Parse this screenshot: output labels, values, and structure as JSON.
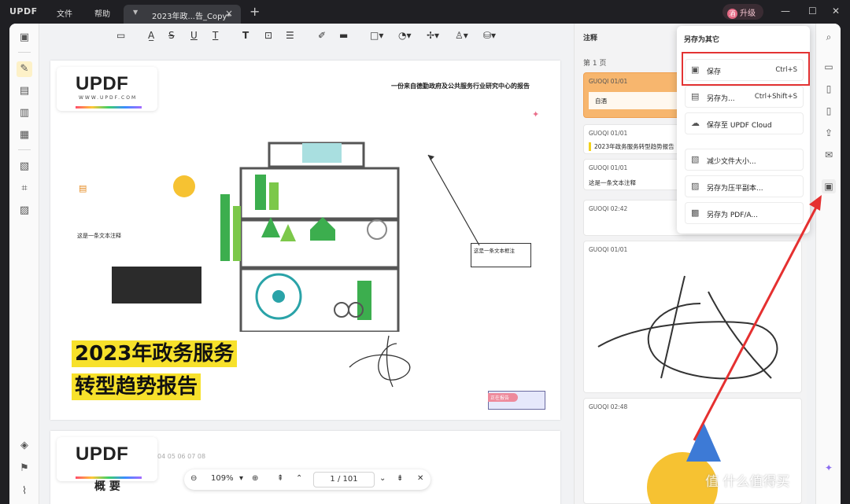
{
  "app": {
    "logo": "UPDF",
    "menus": [
      "文件",
      "帮助"
    ],
    "tab_title": "2023年政...告_Copy*",
    "upgrade": "升级",
    "avatar": "酒"
  },
  "toolbar": {
    "icons": [
      "comment-icon",
      "highlight-icon",
      "strikethrough-icon",
      "underline-icon",
      "squiggly-icon",
      "text-icon",
      "textbox-icon",
      "textcallout-icon",
      "pencil-icon",
      "eraser-icon",
      "shape-icon",
      "sticker-icon",
      "pin-icon",
      "stamp-icon"
    ]
  },
  "document": {
    "logo_word": "UPDF",
    "logo_url": "WWW.UPDF.COM",
    "subtitle": "一份来自德勤政府及公共服务行业研究中心的报告",
    "title_line1": "2023年政务服务",
    "title_line2": "转型趋势报告",
    "note_text": "这是一条文本注释",
    "textbox_text": "这是一条文本框注",
    "tag_text": "正在报告",
    "page2_logo": "UPDF",
    "page2_nums": "04  05  06  07  08",
    "page2_heading": "概 要"
  },
  "pager": {
    "zoom": "109%",
    "page": "1 / 101"
  },
  "annotations": {
    "header": "注释",
    "page_label": "第 1 页",
    "items": [
      {
        "user": "GUOQI 01/01",
        "text": "自酒"
      },
      {
        "user": "GUOQI 01/01",
        "text": "2023年政务服务转型趋势报告"
      },
      {
        "user": "GUOQI 01/01",
        "text": "这是一条文本注释"
      },
      {
        "user": "GUOQI 02:42",
        "text": ""
      },
      {
        "user": "GUOQI 01/01",
        "text": ""
      },
      {
        "user": "GUOQI 02:48",
        "text": ""
      }
    ]
  },
  "save_menu": {
    "title": "另存为其它",
    "items": [
      {
        "label": "保存",
        "shortcut": "Ctrl+S",
        "icon": "save-icon"
      },
      {
        "label": "另存为...",
        "shortcut": "Ctrl+Shift+S",
        "icon": "save-as-icon"
      },
      {
        "label": "保存至 UPDF Cloud",
        "shortcut": "",
        "icon": "cloud-icon"
      },
      {
        "label": "减少文件大小...",
        "shortcut": "",
        "icon": "compress-icon"
      },
      {
        "label": "另存为压平副本...",
        "shortcut": "",
        "icon": "flatten-icon"
      },
      {
        "label": "另存为 PDF/A...",
        "shortcut": "",
        "icon": "pdfa-icon"
      }
    ]
  },
  "watermark": "值 什么值得买"
}
